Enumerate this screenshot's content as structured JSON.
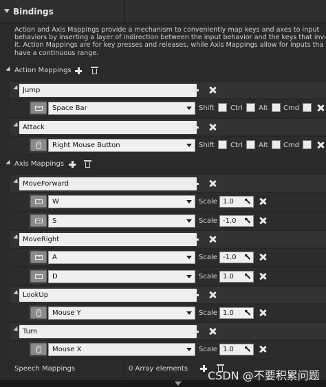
{
  "header": {
    "title": "Bindings"
  },
  "description": [
    "Action and Axis Mappings provide a mechanism to conveniently map keys and axes to input",
    "behaviors by inserting a layer of indirection between the input behavior and the keys that invo",
    "it. Action Mappings are for key presses and releases, while Axis Mappings allow for inputs tha",
    "have a continuous range."
  ],
  "action_section": {
    "label": "Action Mappings"
  },
  "axis_section": {
    "label": "Axis Mappings"
  },
  "modifiers": {
    "shift": "Shift",
    "ctrl": "Ctrl",
    "alt": "Alt",
    "cmd": "Cmd"
  },
  "scale_label": "Scale",
  "actions": [
    {
      "name": "Jump",
      "key": "Space Bar",
      "icon": "keyboard-icon"
    },
    {
      "name": "Attack",
      "key": "Right Mouse Button",
      "icon": "mouse-icon"
    }
  ],
  "axes": [
    {
      "name": "MoveForward",
      "keys": [
        {
          "key": "W",
          "scale": "1.0",
          "icon": "keyboard-icon"
        },
        {
          "key": "S",
          "scale": "-1.0",
          "icon": "keyboard-icon"
        }
      ]
    },
    {
      "name": "MoveRight",
      "keys": [
        {
          "key": "A",
          "scale": "-1.0",
          "icon": "keyboard-icon"
        },
        {
          "key": "D",
          "scale": "1.0",
          "icon": "keyboard-icon"
        }
      ]
    },
    {
      "name": "LookUp",
      "keys": [
        {
          "key": "Mouse Y",
          "scale": "1.0",
          "icon": "mouse-icon"
        }
      ]
    },
    {
      "name": "Turn",
      "keys": [
        {
          "key": "Mouse X",
          "scale": "1.0",
          "icon": "mouse-icon"
        }
      ]
    }
  ],
  "speech": {
    "label": "Speech Mappings",
    "value": "0 Array elements"
  },
  "watermark": "CSDN @不要积累问题"
}
